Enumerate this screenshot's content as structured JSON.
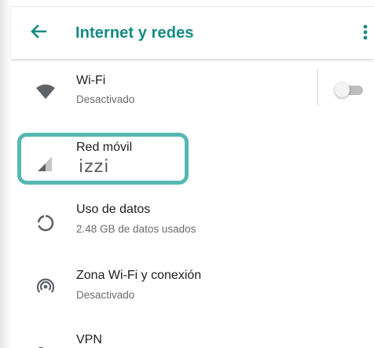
{
  "header": {
    "title": "Internet y redes"
  },
  "items": [
    {
      "label": "Wi-Fi",
      "sub": "Desactivado",
      "icon": "wifi-icon"
    },
    {
      "label": "Red móvil",
      "sub": "izzi",
      "icon": "signal-icon"
    },
    {
      "label": "Uso de datos",
      "sub": "2.48 GB de datos usados",
      "icon": "data-usage-icon"
    },
    {
      "label": "Zona Wi-Fi y conexión",
      "sub": "Desactivado",
      "icon": "hotspot-icon"
    },
    {
      "label": "VPN",
      "icon": "vpn-key-icon"
    }
  ],
  "wifi_toggle": {
    "state": "off"
  },
  "colors": {
    "accent": "#148a83",
    "highlight": "#55b8b2"
  }
}
